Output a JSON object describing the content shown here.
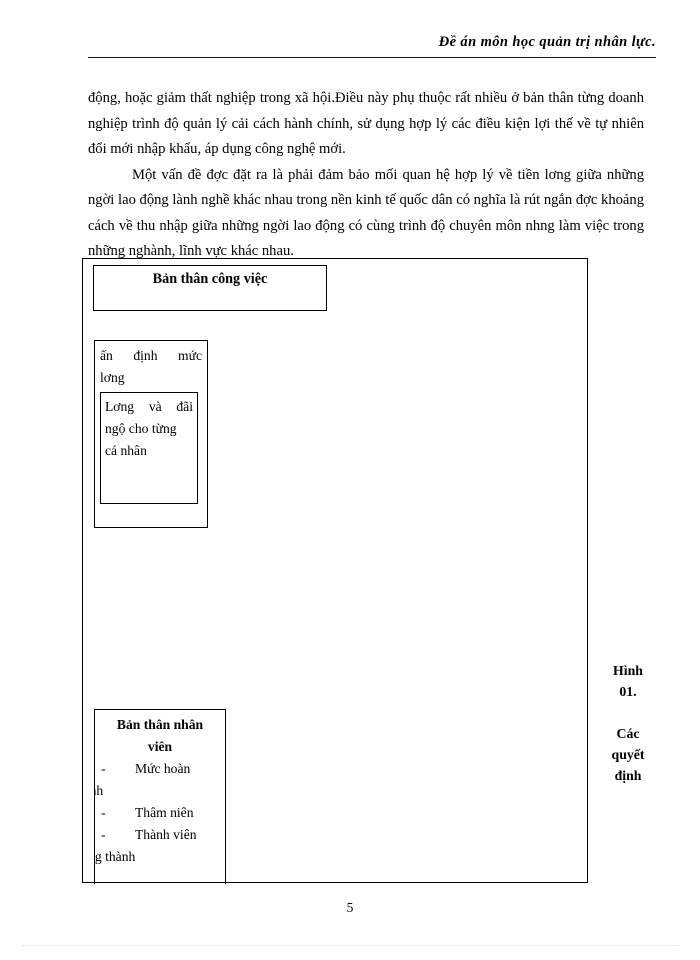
{
  "document": {
    "header_title": "Đề án môn học quản trị nhân lực.",
    "page_number": "5"
  },
  "body": {
    "paragraphs": [
      {
        "indent": false,
        "text": "động, hoặc giảm thất nghiệp trong xã hội.Điều này phụ thuộc rất nhiều ở bản thân từng doanh nghiệp trình độ quản lý cải cách hành chính, sử dụng hợp lý các điều kiện lợi thế về tự nhiên đổi mới nhập khẩu, áp dụng công nghệ mới."
      },
      {
        "indent": true,
        "text": "Một vấn đề đợc  đặt ra là phải đảm bảo mối quan hệ hợp lý về tiền lơng  giữa những ngời  lao động lành nghề khác nhau trong nền kinh tế quốc dân có nghĩa là rút ngắn đợc  khoảng cách về thu nhập giữa những ngời  lao động có cùng trình độ chuyên môn nhng  làm việc trong những nghành, lĩnh vực khác nhau."
      }
    ]
  },
  "figure": {
    "job_box": {
      "title": "Bản thân công việc"
    },
    "pay_box": {
      "heading_line_1": "ấn định mức",
      "heading_line_2": "lơng",
      "inner_box": {
        "line_1": "Lơng và đãi",
        "line_2": "ngộ cho từng",
        "line_3": "cá nhân"
      }
    },
    "staff_box": {
      "title_line_1": "Bản thân nhân",
      "title_line_2": "viên",
      "items": [
        {
          "dash": "-",
          "label": "Mức hoàn",
          "wrap": "thành"
        },
        {
          "dash": "-",
          "label": "Thâm niên",
          "wrap": ""
        },
        {
          "dash": "-",
          "label": "Thành viên",
          "wrap": "trong thành"
        }
      ]
    },
    "caption": {
      "line_1": "Hình",
      "line_2": "01.",
      "line_3": "Các",
      "line_4": "quyết",
      "line_5": "định"
    }
  }
}
